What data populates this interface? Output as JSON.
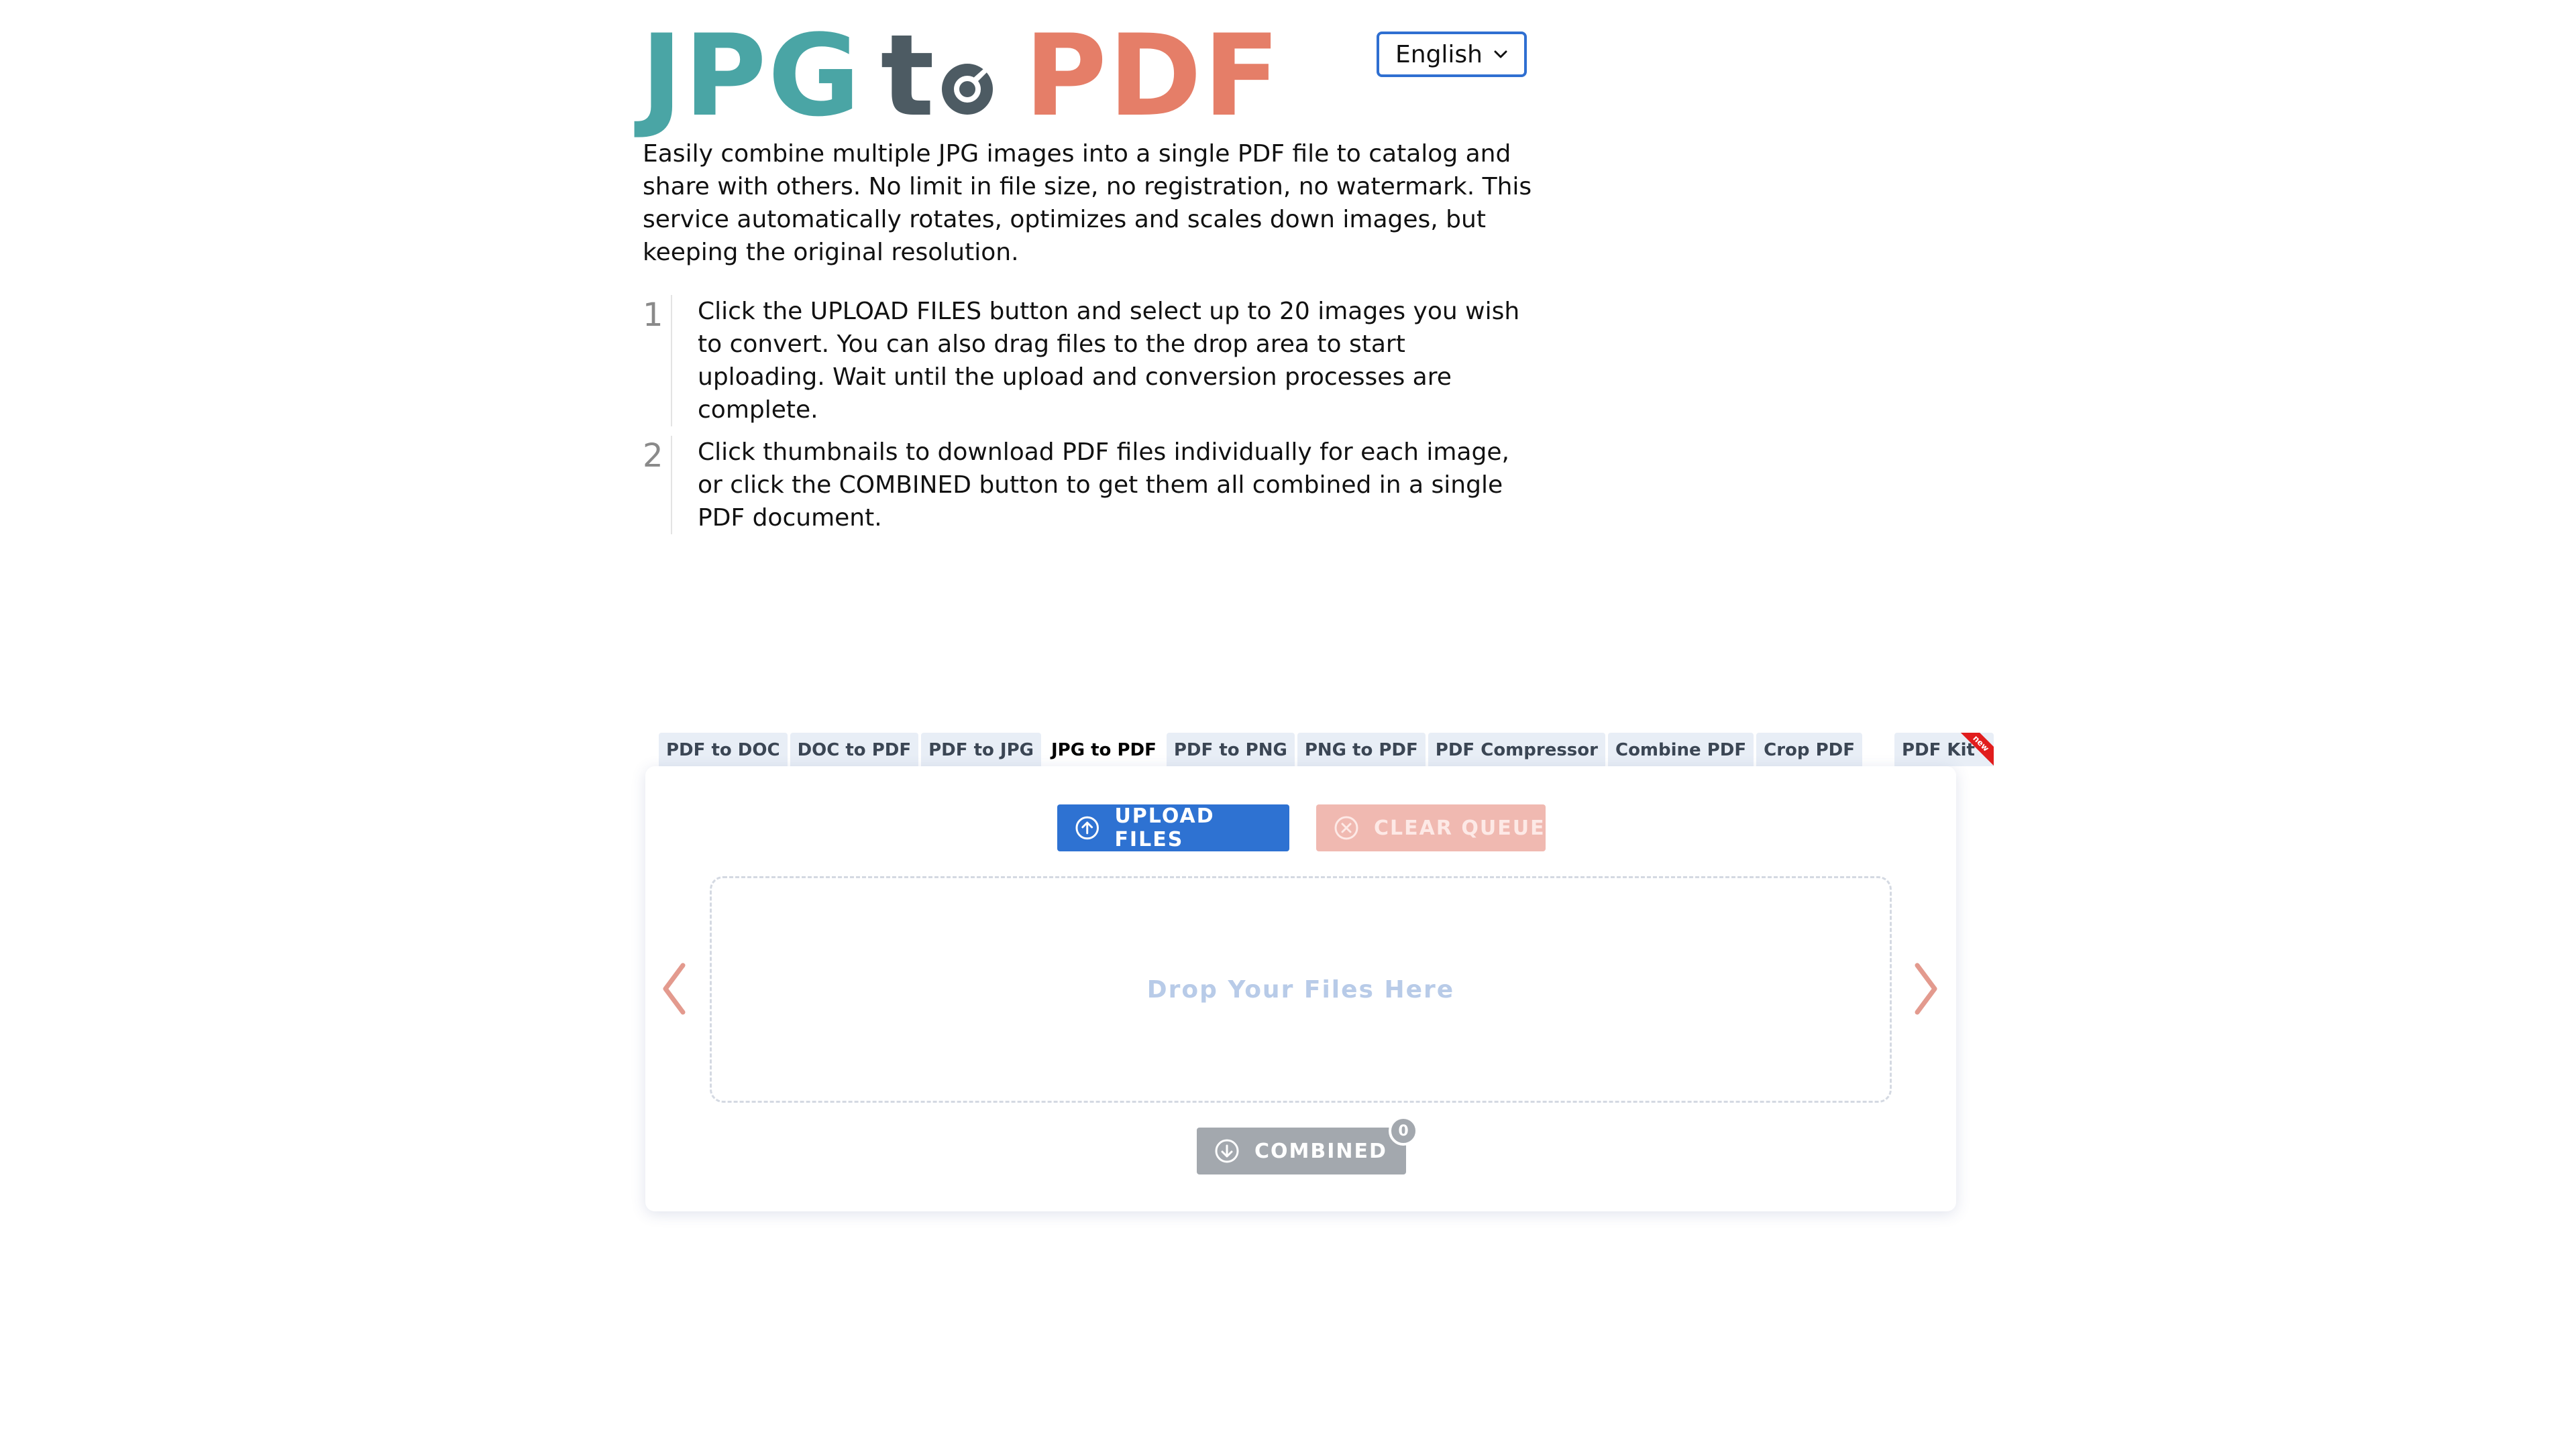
{
  "logo": {
    "word_jpg": "JPG",
    "word_to_t": "t",
    "word_pdf": "PDF",
    "colors": {
      "jpg": "#4aa5a5",
      "to": "#4d5b63",
      "pdf": "#e57e68"
    }
  },
  "language_select": {
    "selected": "English",
    "icon": "chevron-down-icon"
  },
  "intro": {
    "text": "Easily combine multiple JPG images into a single PDF file to catalog and share with others. No limit in file size, no registration, no watermark. This service automatically rotates, optimizes and scales down images, but keeping the original resolution."
  },
  "steps": [
    {
      "number": "1",
      "text": "Click the UPLOAD FILES button and select up to 20 images you wish to convert. You can also drag files to the drop area to start uploading. Wait until the upload and conversion processes are complete."
    },
    {
      "number": "2",
      "text": "Click thumbnails to download PDF files individually for each image, or click the COMBINED button to get them all combined in a single PDF document."
    }
  ],
  "tabs": [
    {
      "label": "PDF to DOC",
      "active": false
    },
    {
      "label": "DOC to PDF",
      "active": false
    },
    {
      "label": "PDF to JPG",
      "active": false
    },
    {
      "label": "JPG to PDF",
      "active": true
    },
    {
      "label": "PDF to PNG",
      "active": false
    },
    {
      "label": "PNG to PDF",
      "active": false
    },
    {
      "label": "PDF Compressor",
      "active": false
    },
    {
      "label": "Combine PDF",
      "active": false
    },
    {
      "label": "Crop PDF",
      "active": false
    }
  ],
  "kit_tab": {
    "label": "PDF Kit",
    "ribbon": "new"
  },
  "panel": {
    "upload_label": "UPLOAD FILES",
    "upload_icon": "arrow-up-circle-icon",
    "clear_label": "CLEAR QUEUE",
    "clear_icon": "x-circle-icon",
    "drop_text": "Drop Your Files Here",
    "combined_label": "COMBINED",
    "combined_icon": "arrow-down-circle-icon",
    "combined_count": "0",
    "colors": {
      "upload": "#2e72d2",
      "clear": "#f0b9b1",
      "combined": "#a3a8ae",
      "arrows": "#e39a8e"
    }
  }
}
